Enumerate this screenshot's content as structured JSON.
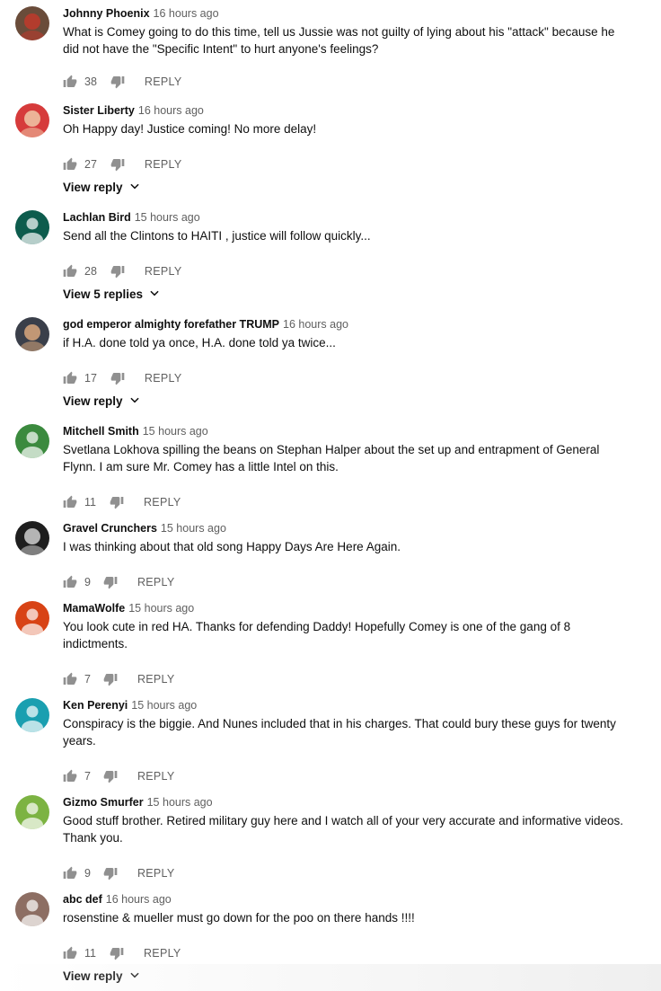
{
  "comments": [
    {
      "author": "Johnny Phoenix",
      "time": "16 hours ago",
      "text": "What is Comey going to do this time, tell us Jussie was not guilty of lying about his \"attack\" because he did not have the \"Specific Intent\" to hurt anyone's feelings?",
      "likes": "38",
      "reply_label": "REPLY",
      "view_replies": null,
      "avatar": {
        "kind": "photo",
        "bg": "#6a4c3a",
        "fg": "#c0392b"
      }
    },
    {
      "author": "Sister Liberty",
      "time": "16 hours ago",
      "text": "Oh Happy day! Justice coming!  No more delay!",
      "likes": "27",
      "reply_label": "REPLY",
      "view_replies": "View reply",
      "avatar": {
        "kind": "photo",
        "bg": "#d63b3b",
        "fg": "#f0c9a8"
      }
    },
    {
      "author": "Lachlan Bird",
      "time": "15 hours ago",
      "text": "Send all the Clintons to HAITI , justice will follow quickly...",
      "likes": "28",
      "reply_label": "REPLY",
      "view_replies": "View 5 replies",
      "avatar": {
        "kind": "default",
        "bg": "#0d5c4d"
      }
    },
    {
      "author": "god emperor almighty forefather TRUMP",
      "time": "16 hours ago",
      "text": "if H.A. done told ya once, H.A. done told ya twice...",
      "likes": "17",
      "reply_label": "REPLY",
      "view_replies": "View reply",
      "avatar": {
        "kind": "photo",
        "bg": "#3a3f4a",
        "fg": "#d9a77c"
      }
    },
    {
      "author": "Mitchell Smith",
      "time": "15 hours ago",
      "text": "Svetlana Lokhova spilling the beans on Stephan Halper about the set up and entrapment of General Flynn. I am sure Mr. Comey has a little Intel on this.",
      "likes": "11",
      "reply_label": "REPLY",
      "view_replies": null,
      "avatar": {
        "kind": "default",
        "bg": "#3b8a3e"
      }
    },
    {
      "author": "Gravel Crunchers",
      "time": "15 hours ago",
      "text": "I was thinking about that old song Happy Days Are Here Again.",
      "likes": "9",
      "reply_label": "REPLY",
      "view_replies": null,
      "avatar": {
        "kind": "photo",
        "bg": "#1e1e1e",
        "fg": "#cfcfcf"
      }
    },
    {
      "author": "MamaWolfe",
      "time": "15 hours ago",
      "text": "You look cute in red HA.  Thanks for defending Daddy!  Hopefully Comey is one of the gang of 8 indictments.",
      "likes": "7",
      "reply_label": "REPLY",
      "view_replies": null,
      "avatar": {
        "kind": "default",
        "bg": "#d84315"
      }
    },
    {
      "author": "Ken Perenyi",
      "time": "15 hours ago",
      "text": "Conspiracy is the biggie. And Nunes included that in his charges. That could bury these guys for twenty years.",
      "likes": "7",
      "reply_label": "REPLY",
      "view_replies": null,
      "avatar": {
        "kind": "default",
        "bg": "#1a9fb0"
      }
    },
    {
      "author": "Gizmo Smurfer",
      "time": "15 hours ago",
      "text": "Good stuff brother. Retired military guy here and I watch all of your very accurate and informative videos. Thank you.",
      "likes": "9",
      "reply_label": "REPLY",
      "view_replies": null,
      "avatar": {
        "kind": "default",
        "bg": "#7cb342"
      }
    },
    {
      "author": "abc def",
      "time": "16 hours ago",
      "text": "rosenstine & mueller must go down for the poo on there hands !!!!",
      "likes": "11",
      "reply_label": "REPLY",
      "view_replies": "View reply",
      "avatar": {
        "kind": "default",
        "bg": "#8d6e63"
      }
    }
  ]
}
